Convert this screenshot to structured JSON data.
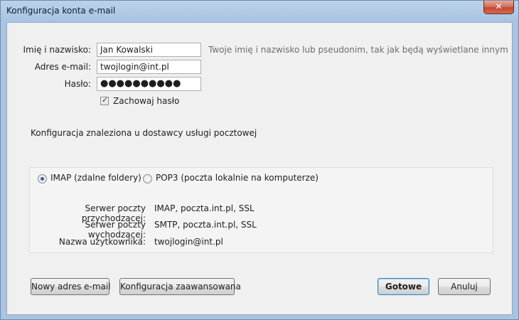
{
  "window": {
    "title": "Konfiguracja konta e-mail",
    "close_label": "✕"
  },
  "form": {
    "name_label": "Imię i nazwisko:",
    "name_value": "Jan Kowalski",
    "name_hint": "Twoje imię i nazwisko lub pseudonim, tak jak będą wyświetlane innym",
    "email_label": "Adres e-mail:",
    "email_value": "twojlogin@int.pl",
    "password_label": "Hasło:",
    "password_value": "●●●●●●●●●●",
    "remember_label": "Zachowaj hasło",
    "remember_checked": true
  },
  "status": {
    "found_text": "Konfiguracja znaleziona u dostawcy usługi pocztowej"
  },
  "protocols": {
    "imap_label": "IMAP (zdalne foldery)",
    "pop3_label": "POP3 (poczta lokalnie na komputerze)",
    "selected": "IMAP"
  },
  "servers": {
    "incoming_label": "Serwer poczty przychodzącej:",
    "incoming_value": "IMAP, poczta.int.pl, SSL",
    "outgoing_label": "Serwer poczty wychodzącej:",
    "outgoing_value": "SMTP, poczta.int.pl, SSL",
    "username_label": "Nazwa użytkownika:",
    "username_value": "twojlogin@int.pl"
  },
  "buttons": {
    "new_address": "Nowy adres e-mail",
    "advanced": "Konfiguracja zaawansowana",
    "done": "Gotowe",
    "cancel": "Anuluj"
  }
}
